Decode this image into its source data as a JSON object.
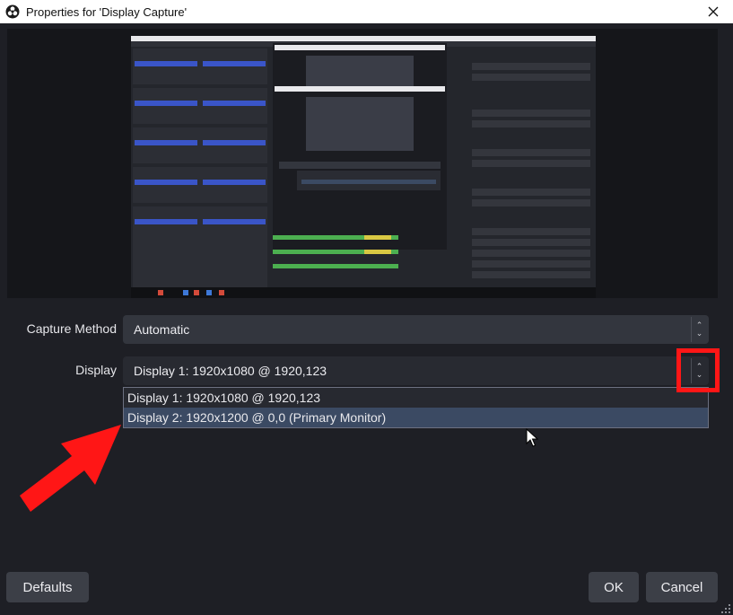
{
  "window": {
    "title": "Properties for 'Display Capture'"
  },
  "capture_method": {
    "label": "Capture Method",
    "value": "Automatic"
  },
  "display": {
    "label": "Display",
    "value": "Display 1: 1920x1080 @ 1920,123",
    "options": [
      {
        "label": "Display 1: 1920x1080 @ 1920,123",
        "highlighted": false
      },
      {
        "label": "Display 2: 1920x1200 @ 0,0 (Primary Monitor)",
        "highlighted": true
      }
    ]
  },
  "buttons": {
    "defaults": "Defaults",
    "ok": "OK",
    "cancel": "Cancel"
  },
  "annotation": {
    "color": "#ff1616"
  },
  "icons": {
    "app": "obs-logo-icon",
    "close": "close-icon",
    "spin": "up-down-chevron-icon",
    "cursor": "mouse-pointer-icon"
  }
}
